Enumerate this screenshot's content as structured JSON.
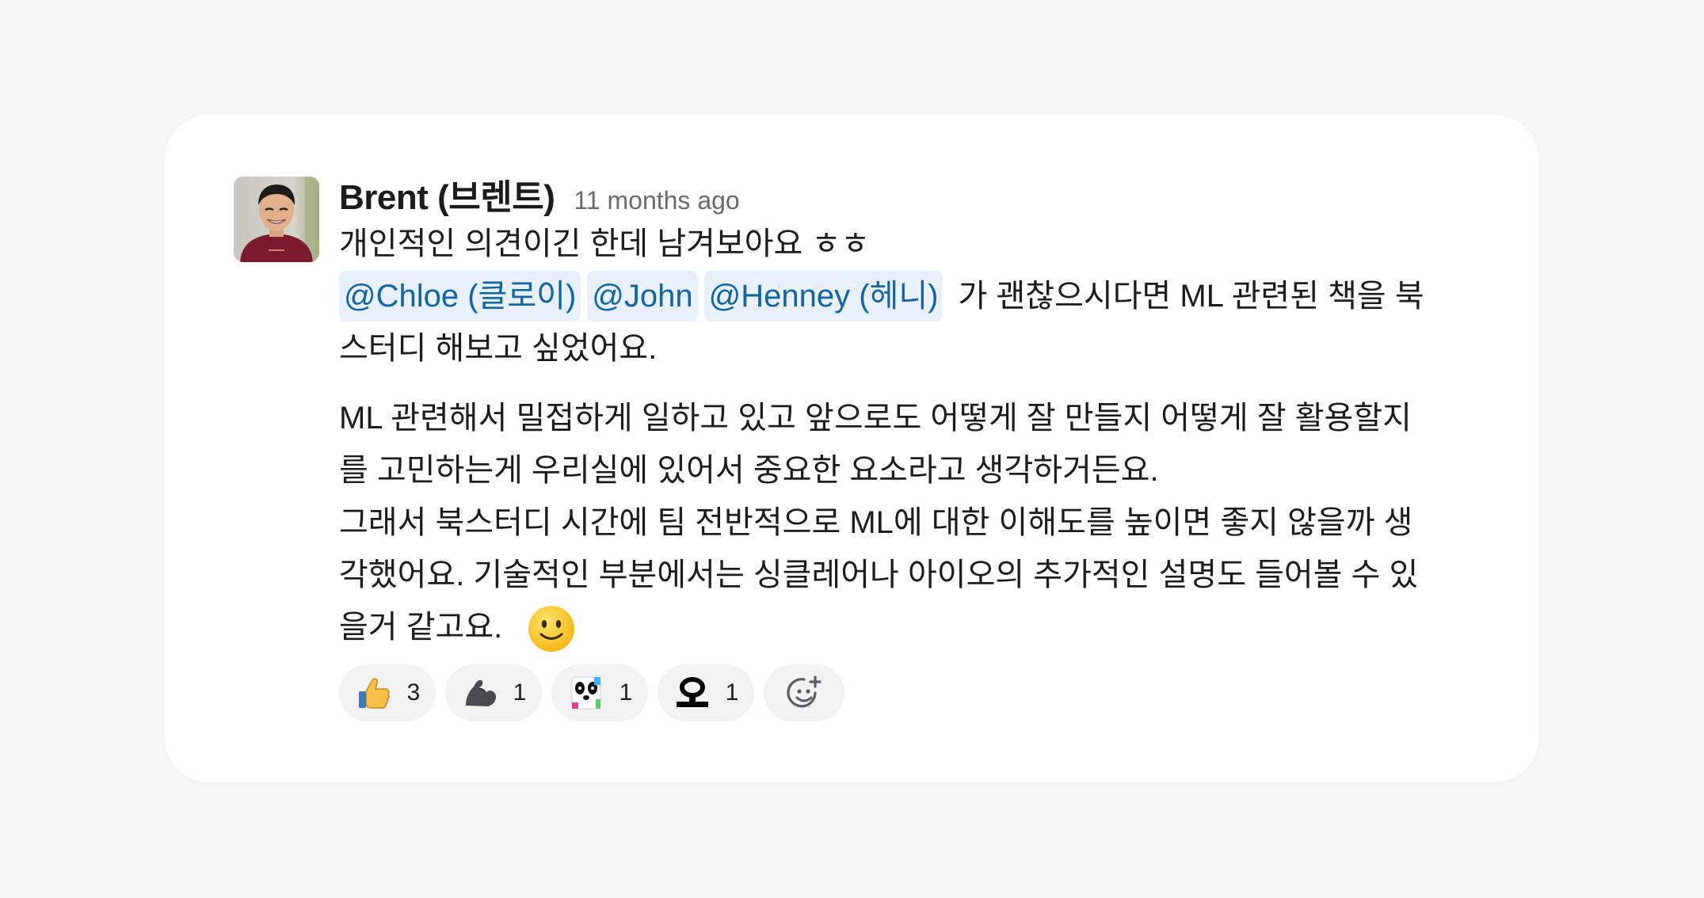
{
  "message": {
    "author": "Brent (브렌트)",
    "timestamp": "11 months ago",
    "line1": "개인적인 의견이긴 한데 남겨보아요 ㅎㅎ",
    "mentions": [
      "@Chloe (클로이)",
      "@John",
      "@Henney (헤니)"
    ],
    "line2_tail": " 가 괜찮으시다면 ML 관련된 책을 북",
    "line3": "스터디 해보고 싶었어요.",
    "para2_line1": "ML 관련해서 밀접하게 일하고 있고 앞으로도 어떻게 잘 만들지 어떻게 잘 활용할지",
    "para2_line2": "를 고민하는게 우리실에 있어서 중요한 요소라고 생각하거든요.",
    "para2_line3": "그래서 북스터디 시간에 팀 전반적으로 ML에 대한 이해도를 높이면 좋지 않을까 생",
    "para2_line4": "각했어요. 기술적인 부분에서는 싱클레어나 아이오의 추가적인 설명도 들어볼 수 있",
    "para2_line5": "을거 같고요.",
    "inline_emoji": "slightly-smiling-face-icon"
  },
  "reactions": [
    {
      "icon": "thumbs-up-icon",
      "count": "3"
    },
    {
      "icon": "flexed-biceps-icon",
      "count": "1"
    },
    {
      "icon": "panda-sticker-icon",
      "count": "1"
    },
    {
      "icon": "oh-text-icon",
      "count": "1"
    }
  ],
  "add_reaction_icon": "add-reaction-icon",
  "colors": {
    "background": "#f8f8f9",
    "card": "#ffffff",
    "mention_bg": "#e8f1fa",
    "mention_text": "#1264a3",
    "reaction_bg": "#f2f2f3"
  }
}
